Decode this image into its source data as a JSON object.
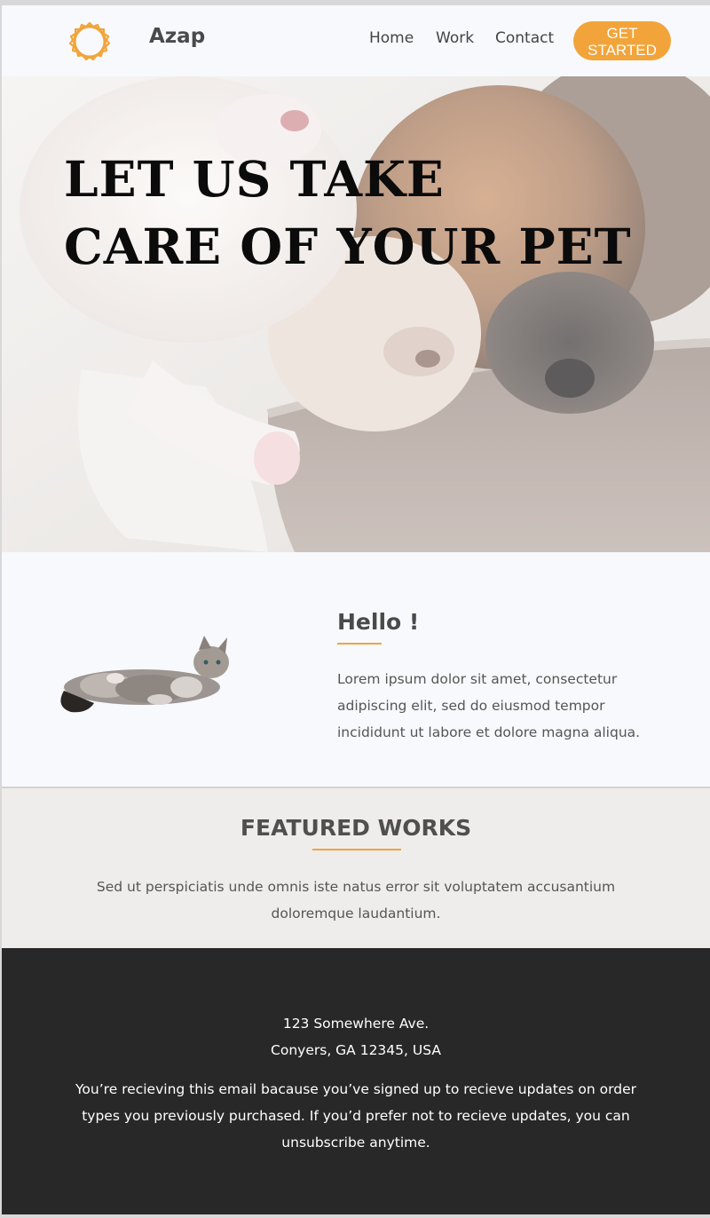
{
  "header": {
    "brand": "Azap",
    "nav": [
      "Home",
      "Work",
      "Contact"
    ],
    "cta_line1": "GET",
    "cta_line2": "STARTED"
  },
  "hero": {
    "title_line1": "LET US TAKE",
    "title_line2": "CARE OF YOUR PET"
  },
  "hello": {
    "title": "Hello !",
    "text": "Lorem ipsum dolor sit amet, consectetur adipiscing elit, sed do eiusmod tempor incididunt ut labore et dolore magna aliqua."
  },
  "featured": {
    "title": "FEATURED WORKS",
    "text": "Sed ut perspiciatis unde omnis iste natus error sit voluptatem accusantium doloremque laudantium."
  },
  "footer": {
    "address_line1": "123 Somewhere Ave.",
    "address_line2": "Conyers, GA 12345, USA",
    "note": "You’re recieving this email bacause you’ve signed up to recieve updates on order types you previously purchased. If you’d prefer not to recieve updates, you can unsubscribe anytime."
  },
  "colors": {
    "accent": "#f2a43a",
    "footer_bg": "#282828",
    "featured_bg": "#eeedeb",
    "page_bg": "#f7f9fc"
  },
  "icons": {
    "logo": "sun-badge-icon"
  }
}
